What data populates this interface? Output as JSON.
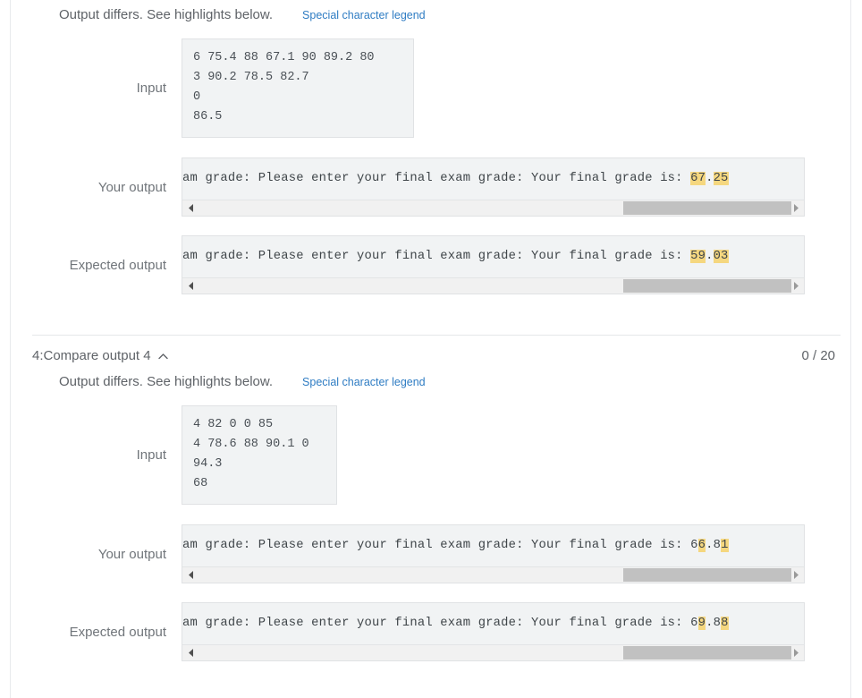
{
  "top_clipped_fragment": "",
  "sections": [
    {
      "id": "section-3",
      "header_visible": false,
      "title": "",
      "score": "",
      "differs_text": "Output differs. See highlights below.",
      "legend_link": "Special character legend",
      "input_label": "Input",
      "input_value": "6 75.4 88 67.1 90 89.2 80\n3 90.2 78.5 82.7\n0\n86.5",
      "your_output_label": "Your output",
      "your_output_prefix": "am grade: Please enter your final exam grade: Your final grade is: ",
      "your_output_segments": [
        {
          "text": "67",
          "highlight": true
        },
        {
          "text": ".",
          "highlight": false
        },
        {
          "text": "25",
          "highlight": true
        }
      ],
      "expected_output_label": "Expected output",
      "expected_output_prefix": "am grade: Please enter your final exam grade: Your final grade is: ",
      "expected_output_segments": [
        {
          "text": "59",
          "highlight": true
        },
        {
          "text": ".",
          "highlight": false
        },
        {
          "text": "03",
          "highlight": true
        }
      ]
    },
    {
      "id": "section-4",
      "header_visible": true,
      "title": "4:Compare output 4",
      "score": "0 / 20",
      "differs_text": "Output differs. See highlights below.",
      "legend_link": "Special character legend",
      "input_label": "Input",
      "input_value": "4 82 0 0 85\n4 78.6 88 90.1 0\n94.3\n68",
      "your_output_label": "Your output",
      "your_output_prefix": "am grade: Please enter your final exam grade: Your final grade is: ",
      "your_output_segments": [
        {
          "text": "6",
          "highlight": false
        },
        {
          "text": "6",
          "highlight": true
        },
        {
          "text": ".8",
          "highlight": false
        },
        {
          "text": "1",
          "highlight": true
        }
      ],
      "expected_output_label": "Expected output",
      "expected_output_prefix": "am grade: Please enter your final exam grade: Your final grade is: ",
      "expected_output_segments": [
        {
          "text": "6",
          "highlight": false
        },
        {
          "text": "9",
          "highlight": true
        },
        {
          "text": ".8",
          "highlight": false
        },
        {
          "text": "8",
          "highlight": true
        }
      ]
    }
  ],
  "icons": {
    "collapse": "chevron-up-icon",
    "scroll_left": "scroll-left-arrow-icon",
    "scroll_right": "scroll-right-arrow-icon"
  },
  "colors": {
    "highlight": "#f5d77f",
    "link": "#2e7cc3",
    "text": "#5f6368",
    "box_bg": "#f1f3f4",
    "scroll_thumb": "#c1c1c1"
  },
  "scrollbars": {
    "thumb_left_pct": 71,
    "thumb_width_pct": 27
  }
}
